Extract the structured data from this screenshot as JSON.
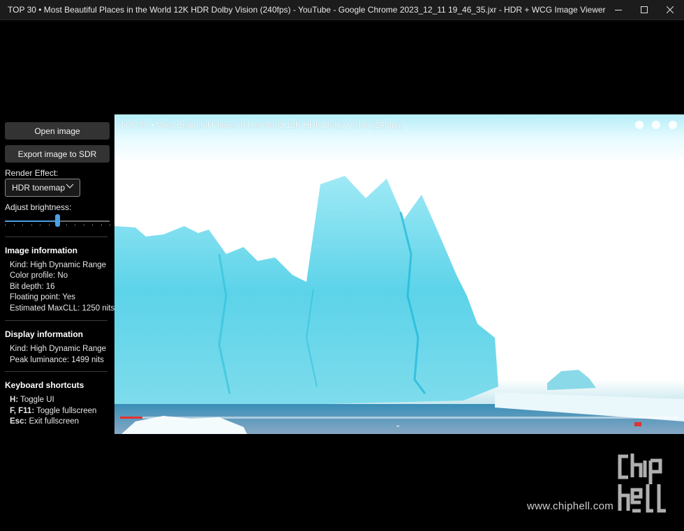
{
  "window": {
    "title": "TOP 30 • Most Beautiful Places in the World 12K HDR Dolby Vision (240fps) - YouTube - Google Chrome 2023_12_11 19_46_35.jxr - HDR + WCG Image Viewer",
    "minimize_icon": "minimize-icon",
    "maximize_icon": "maximize-icon",
    "close_icon": "close-icon"
  },
  "panel": {
    "open_button": "Open image",
    "export_button": "Export image to SDR",
    "render_effect_label": "Render Effect:",
    "render_effect_value": "HDR tonemap",
    "brightness_label": "Adjust brightness:",
    "brightness_level": 0.5
  },
  "image_info": {
    "heading": "Image information",
    "kind": "Kind: High Dynamic Range",
    "color_profile": "Color profile: No",
    "bit_depth": "Bit depth: 16",
    "floating_point": "Floating point: Yes",
    "maxcll": "Estimated MaxCLL: 1250 nits"
  },
  "display_info": {
    "heading": "Display information",
    "kind": "Kind: High Dynamic Range",
    "peak": "Peak luminance: 1499 nits"
  },
  "shortcuts": {
    "heading": "Keyboard shortcuts",
    "items": [
      {
        "key": "H:",
        "desc": " Toggle UI"
      },
      {
        "key": "F, F11:",
        "desc": " Toggle fullscreen"
      },
      {
        "key": "Esc:",
        "desc": " Exit fullscreen"
      }
    ]
  },
  "image": {
    "video_title": "TOP 30 • Most Beautiful Places in the World 12K HDR Dolby Vision (240fps)",
    "progress": 0.04
  },
  "watermark": {
    "site": "www.chiphell.com",
    "logo_text": "chip hell"
  },
  "colors": {
    "accent": "#4aa0e6",
    "button_bg": "#333333",
    "ice": "#5fd6ea"
  }
}
